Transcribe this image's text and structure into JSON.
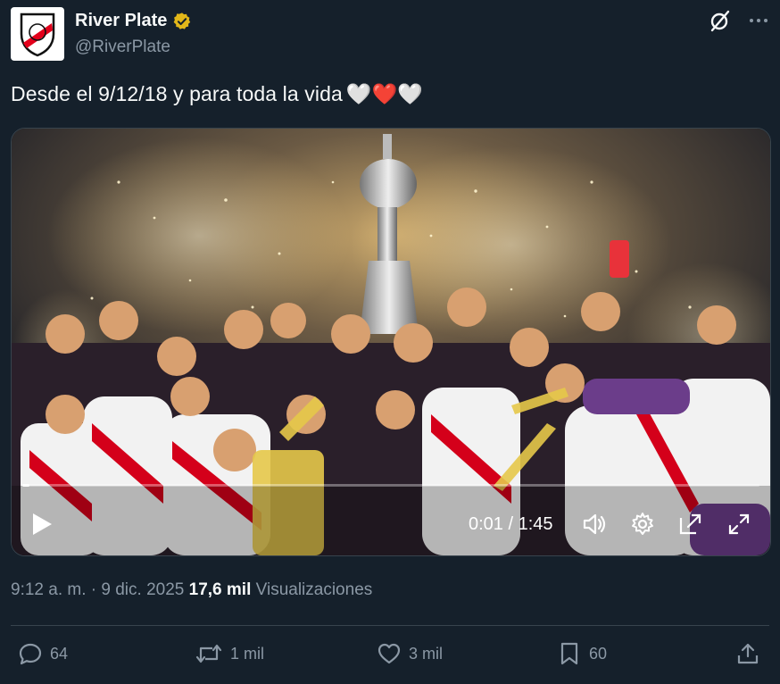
{
  "account": {
    "display_name": "River Plate",
    "handle": "@RiverPlate",
    "verified_color": "#e2b719",
    "avatar_icon": "river-plate-crest-icon"
  },
  "tweet": {
    "text": "Desde el 9/12/18 y para toda la vida",
    "hearts": "🤍❤️🤍"
  },
  "video": {
    "current_time": "0:01",
    "duration": "1:45",
    "time_display": "0:01 / 1:45",
    "progress": 0.01,
    "controls": [
      "play-icon",
      "volume-icon",
      "settings-icon",
      "pip-icon",
      "fullscreen-icon"
    ]
  },
  "meta": {
    "time": "9:12 a. m.",
    "separator": " · ",
    "date": "9 dic. 2025",
    "views_count": "17,6 mil",
    "views_label": "Visualizaciones"
  },
  "actions": {
    "replies": "64",
    "reposts": "1 mil",
    "likes": "3 mil",
    "bookmarks": "60"
  },
  "colors": {
    "background": "#15202b",
    "text": "#f7f9f9",
    "secondary": "#8b98a5",
    "border": "#38444d"
  }
}
